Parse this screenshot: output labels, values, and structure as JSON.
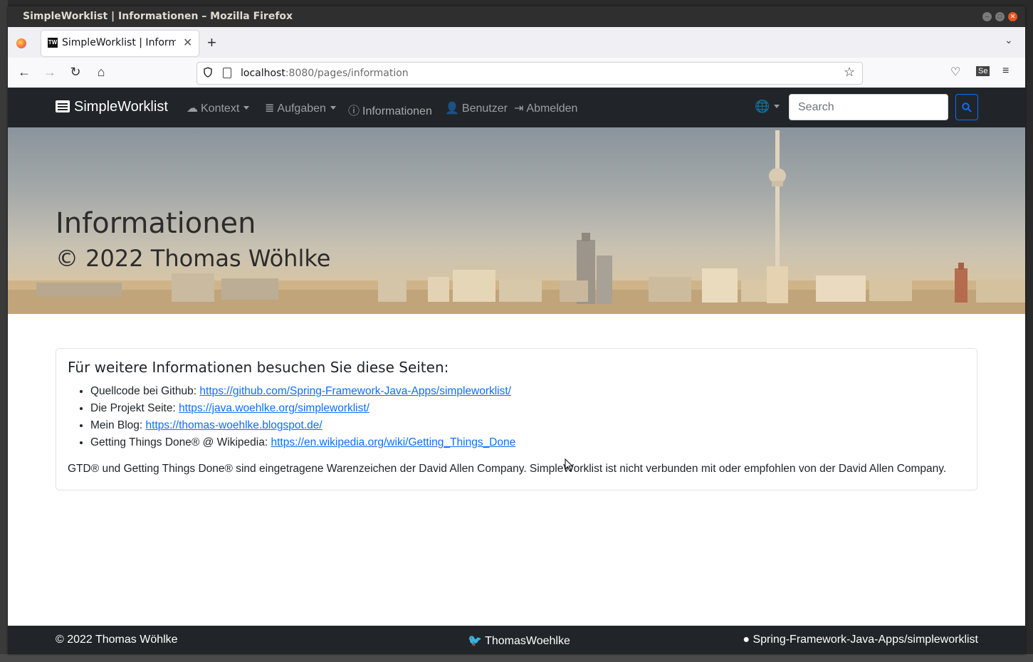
{
  "window": {
    "title": "SimpleWorklist | Informationen – Mozilla Firefox"
  },
  "browser": {
    "tab_label": "SimpleWorklist | Informationen",
    "new_tab": "+",
    "url_host": "localhost",
    "url_rest": ":8080/pages/information"
  },
  "nav": {
    "brand": "SimpleWorklist",
    "kontext": "Kontext",
    "aufgaben": "Aufgaben",
    "informationen": "Informationen",
    "benutzer": "Benutzer",
    "abmelden": "Abmelden",
    "search_placeholder": "Search"
  },
  "hero": {
    "title": "Informationen",
    "subtitle": "© 2022 Thomas Wöhlke"
  },
  "card": {
    "heading": "Für weitere Informationen besuchen Sie diese Seiten:",
    "items": [
      {
        "label": "Quellcode bei Github:",
        "link": "https://github.com/Spring-Framework-Java-Apps/simpleworklist/"
      },
      {
        "label": "Die Projekt Seite:",
        "link": "https://java.woehlke.org/simpleworklist/"
      },
      {
        "label": "Mein Blog:",
        "link": "https://thomas-woehlke.blogspot.de/"
      },
      {
        "label": "Getting Things Done® @ Wikipedia:",
        "link": "https://en.wikipedia.org/wiki/Getting_Things_Done"
      }
    ],
    "note": "GTD® und Getting Things Done® sind eingetragene Warenzeichen der David Allen Company. SimpleWorklist ist nicht verbunden mit oder empfohlen von der David Allen Company."
  },
  "footer": {
    "copyright": "© 2022 Thomas Wöhlke",
    "twitter": "ThomasWoehlke",
    "github": "Spring-Framework-Java-Apps/simpleworklist"
  },
  "colors": {
    "navbar": "#212529",
    "link": "#0d6efd",
    "search_button_border": "#0d6efd",
    "close_button": "#e95420"
  }
}
